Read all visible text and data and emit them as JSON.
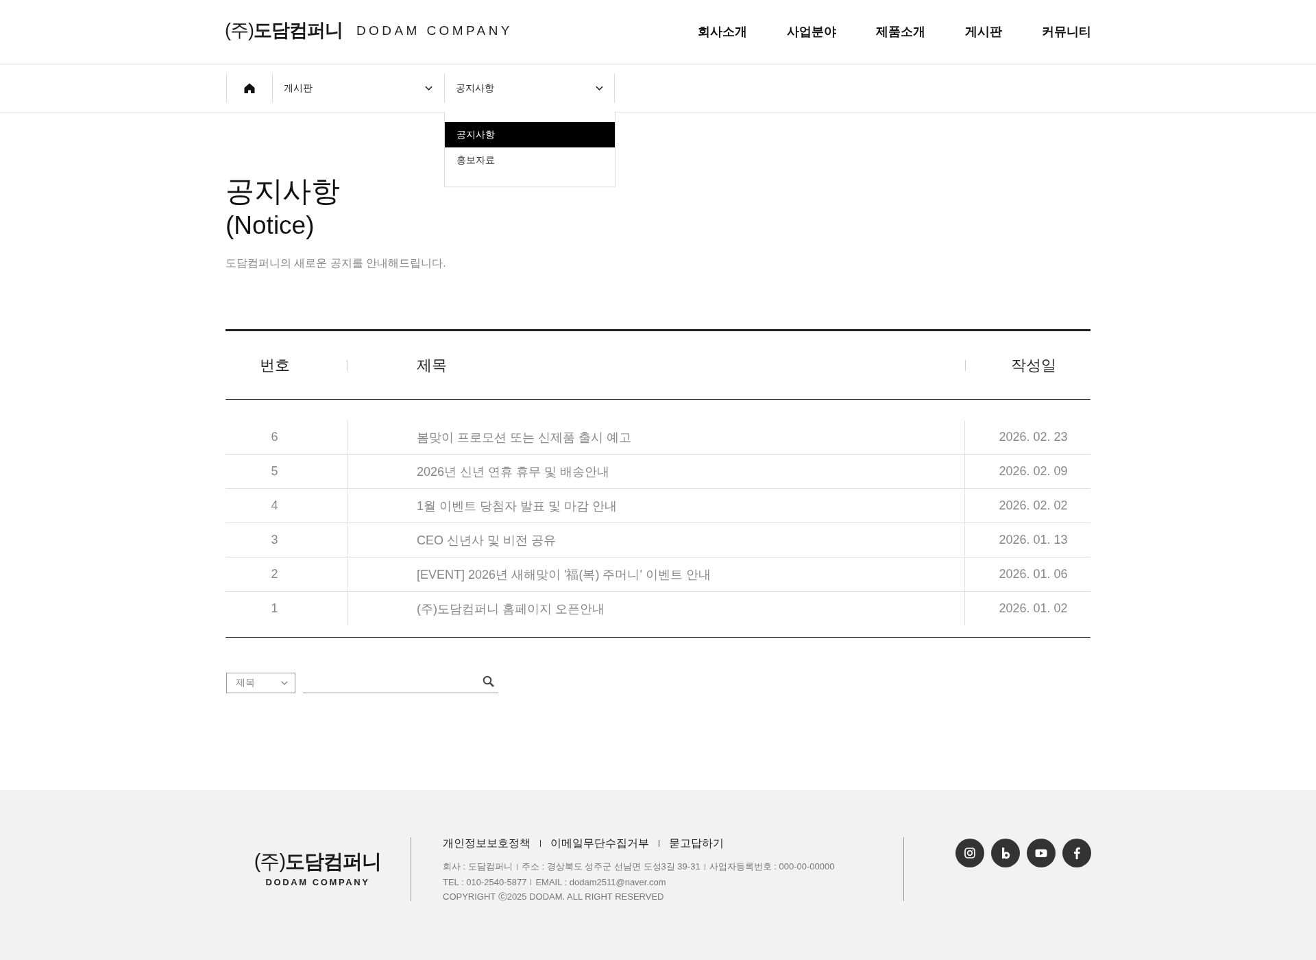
{
  "header": {
    "logo": {
      "name": "(주)**도담컴퍼니**",
      "english": "DODAM COMPANY"
    },
    "nav": [
      "회사소개",
      "사업분야",
      "제품소개",
      "게시판",
      "커뮤니티"
    ]
  },
  "breadcrumb": {
    "dropdowns": [
      {
        "label": "게시판",
        "expanded": false
      },
      {
        "label": "공지사항",
        "expanded": true,
        "options": [
          {
            "label": "공지사항",
            "selected": true
          },
          {
            "label": "홍보자료",
            "selected": false
          }
        ]
      }
    ]
  },
  "heading": {
    "title": "공지사항",
    "subtitle": "(Notice)",
    "description": "도담컴퍼니의 새로운 공지를 안내해드립니다."
  },
  "table": {
    "columns": [
      "번호",
      "제목",
      "작성일"
    ],
    "rows": [
      {
        "number": "6",
        "title": "봄맞이 프로모션 또는 신제품 출시 예고",
        "date": "2026. 02. 23"
      },
      {
        "number": "5",
        "title": "2026년 신년 연휴 휴무 및 배송안내",
        "date": "2026. 02. 09"
      },
      {
        "number": "4",
        "title": "1월 이벤트 당첨자 발표 및 마감 안내",
        "date": "2026. 02. 02"
      },
      {
        "number": "3",
        "title": "CEO 신년사 및 비전 공유",
        "date": "2026. 01. 13"
      },
      {
        "number": "2",
        "title": "[EVENT] 2026년 새해맞이 '福(복) 주머니' 이벤트 안내",
        "date": "2026. 01. 06"
      },
      {
        "number": "1",
        "title": "(주)도담컴퍼니 홈페이지 오픈안내",
        "date": "2026. 01. 02"
      }
    ]
  },
  "search": {
    "scope": "제목"
  },
  "footer": {
    "logo": {
      "name": "(주)**도담컴퍼니**",
      "english": "DODAM COMPANY"
    },
    "links": [
      "개인정보보호정책",
      "이메일무단수집거부",
      "묻고답하기"
    ],
    "info": [
      [
        "회사 : 도담컴퍼니",
        "주소 : 경상북도 성주군 선남면 도성3길 39-31",
        "사업자등록번호 : 000-00-00000"
      ],
      [
        "TEL : 010-2540-5877",
        "EMAIL : dodam2511@naver.com"
      ],
      [
        "COPYRIGHT ⓒ2025 DODAM. ALL RIGHT RESERVED"
      ]
    ]
  }
}
